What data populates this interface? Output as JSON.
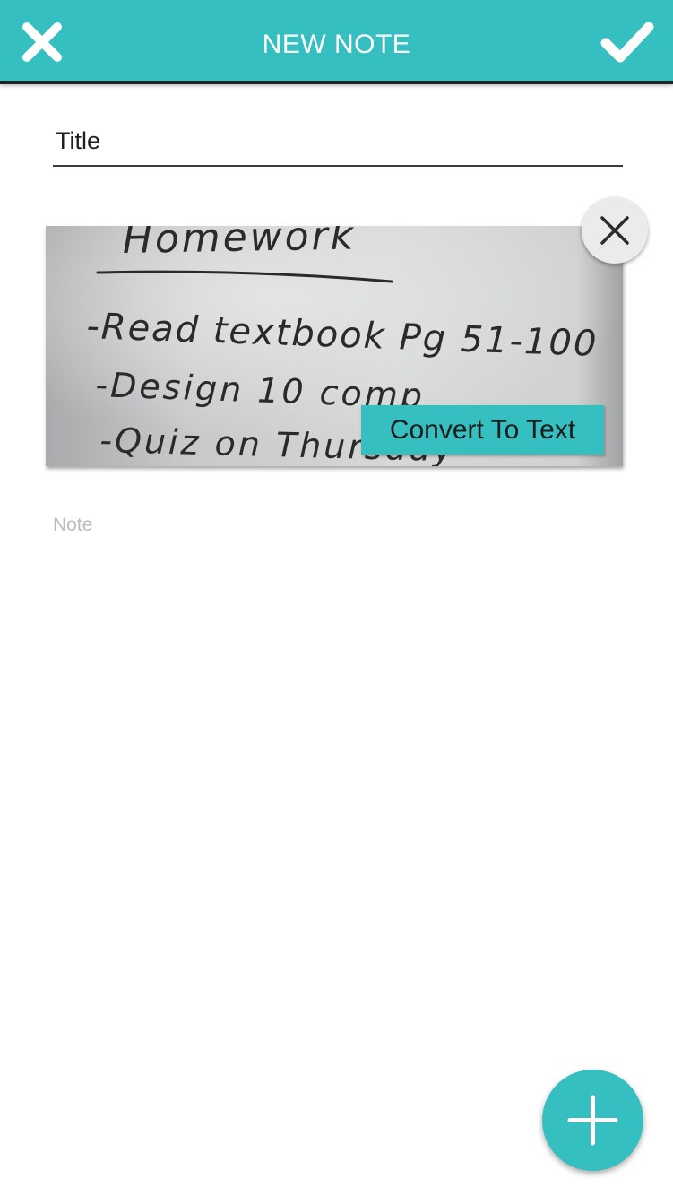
{
  "header": {
    "title": "NEW NOTE",
    "close_icon": "close-icon",
    "confirm_icon": "checkmark-icon"
  },
  "form": {
    "title_placeholder": "Title",
    "note_placeholder": "Note"
  },
  "attachment": {
    "handwriting_lines": [
      "Homework",
      "-Read textbook Pg 51-100",
      "-Design 10 comp",
      "-Quiz on Thursday"
    ],
    "remove_icon": "close-icon",
    "convert_label": "Convert To Text"
  },
  "fab": {
    "icon": "plus-icon"
  },
  "colors": {
    "accent": "#35bfc0",
    "header_border": "#1d2424",
    "placeholder": "#b9bcc0"
  }
}
